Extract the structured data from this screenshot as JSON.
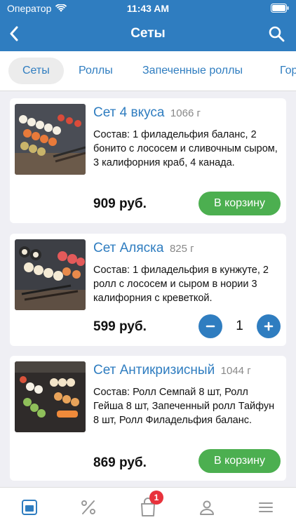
{
  "status_bar": {
    "carrier": "Оператор",
    "time": "11:43 AM"
  },
  "navbar": {
    "title": "Сеты"
  },
  "categories": [
    {
      "label": "Сеты",
      "active": true
    },
    {
      "label": "Роллы",
      "active": false
    },
    {
      "label": "Запеченные роллы",
      "active": false
    },
    {
      "label": "Гор",
      "active": false
    }
  ],
  "products": [
    {
      "name": "Сет 4 вкуса",
      "weight": "1066 г",
      "description": "Состав: 1 филадельфия баланс, 2 бонито с лососем и сливочным сыром, 3 калифорния краб, 4 канада.",
      "price": "909 руб.",
      "cart_label": "В корзину"
    },
    {
      "name": "Сет Аляска",
      "weight": "825 г",
      "description": "Состав: 1 филадельфия в кунжуте, 2 ролл с лососем и сыром в нории 3 калифорния с креветкой.",
      "price": "599 руб.",
      "quantity": "1"
    },
    {
      "name": "Сет Антикризисный",
      "weight": "1044 г",
      "description": "Состав: Ролл Семпай 8 шт, Ролл Гейша 8 шт, Запеченный ролл Тайфун 8 шт, Ролл Филадельфия баланс.",
      "price": "869 руб.",
      "cart_label": "В корзину"
    }
  ],
  "tabbar": {
    "items": [
      "menu-icon",
      "discount-icon",
      "cart-icon",
      "profile-icon",
      "more-icon"
    ],
    "cart_badge": "1"
  },
  "colors": {
    "primary": "#2f7dc0",
    "cart_button": "#4caf50",
    "badge": "#e8323c",
    "background": "#efeff4"
  }
}
